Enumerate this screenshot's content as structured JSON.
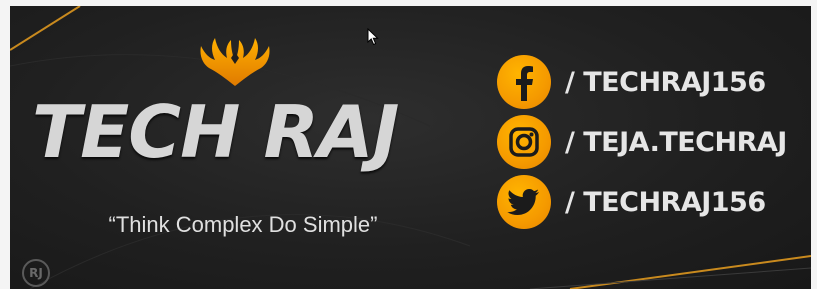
{
  "brand": {
    "title": "TECH RAJ",
    "tagline": "“Think Complex Do Simple”",
    "corner_logo": "RJ"
  },
  "social": [
    {
      "platform": "facebook",
      "icon": "facebook-icon",
      "handle": "/ TECHRAJ156"
    },
    {
      "platform": "instagram",
      "icon": "instagram-icon",
      "handle": "/ TEJA.TECHRAJ"
    },
    {
      "platform": "twitter",
      "icon": "twitter-icon",
      "handle": "/ TECHRAJ156"
    }
  ],
  "colors": {
    "background": "#202020",
    "accent": "#f59a00",
    "title": "#d6d6d6",
    "text": "#e6e6e6"
  }
}
